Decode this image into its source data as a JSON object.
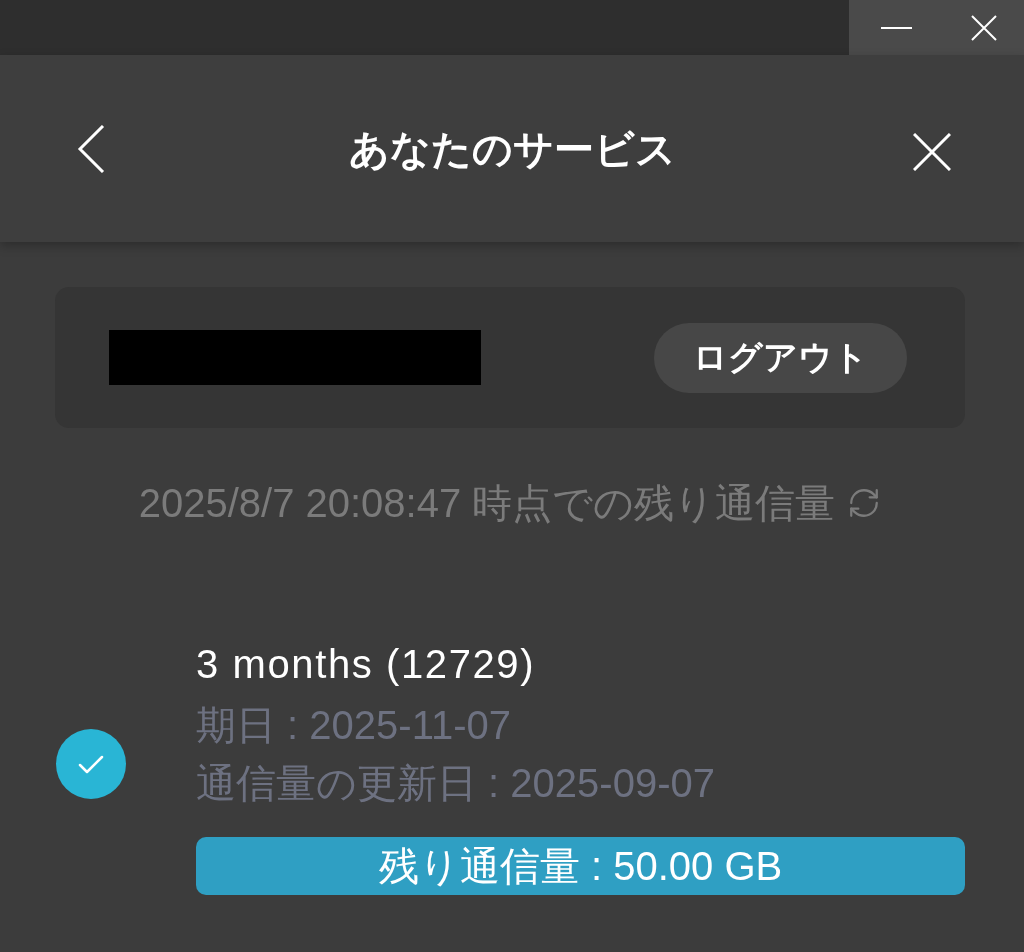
{
  "header": {
    "title": "あなたのサービス"
  },
  "account": {
    "logout_button": "ログアウト"
  },
  "usage_timestamp": "2025/8/7 20:08:47 時点での残り通信量",
  "plans": [
    {
      "kind": "plan",
      "title": "3 months (12729)",
      "selected": true,
      "expiry": "期日 : 2025-11-07",
      "renewal": "通信量の更新日 : 2025-09-07",
      "remaining": "残り通信量 : 50.00 GB"
    }
  ]
}
